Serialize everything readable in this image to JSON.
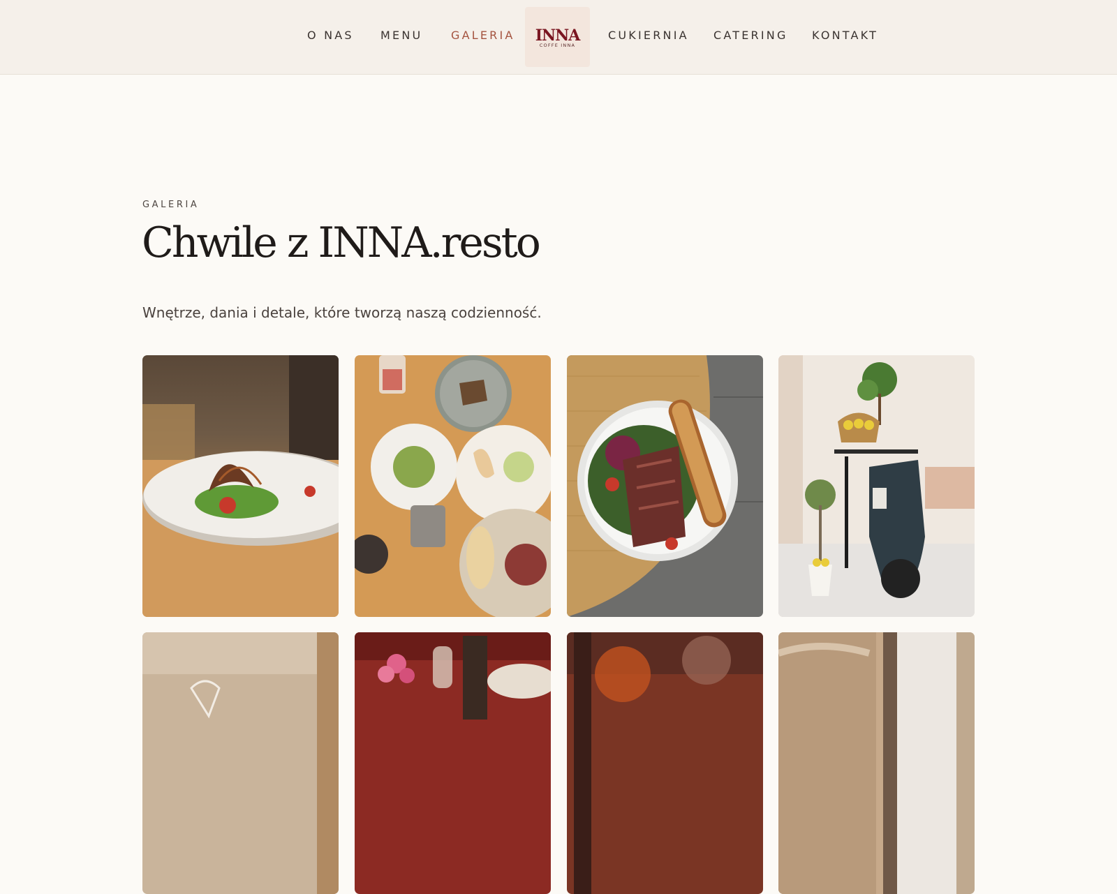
{
  "nav": {
    "left": [
      "O NAS",
      "MENU",
      "GALERIA"
    ],
    "right": [
      "CUKIERNIA",
      "CATERING",
      "KONTAKT"
    ],
    "active": "GALERIA",
    "logo_text": "INNA",
    "logo_subtext": "COFFE INNA"
  },
  "gallery_section": {
    "eyebrow": "GALERIA",
    "title": "Chwile z INNA.resto",
    "subtitle": "Wnętrze, dania i detale, które tworzą naszą codzienność."
  },
  "gallery": {
    "images": [
      {
        "name": "gallery-photo-salad-plate-on-table"
      },
      {
        "name": "gallery-photo-table-with-many-dishes"
      },
      {
        "name": "gallery-photo-duck-salad-with-toast"
      },
      {
        "name": "gallery-photo-vintage-scooter-interior"
      },
      {
        "name": "gallery-photo-restaurant-interior-glasses"
      },
      {
        "name": "gallery-photo-flowers-and-wine"
      },
      {
        "name": "gallery-photo-blurred-dish"
      },
      {
        "name": "gallery-photo-interior-doorway"
      }
    ]
  },
  "colors": {
    "header_bg": "#f5f0ea",
    "page_bg": "#fcfaf6",
    "accent": "#a4533f",
    "logo": "#7a1621",
    "text": "#1f1b19"
  }
}
